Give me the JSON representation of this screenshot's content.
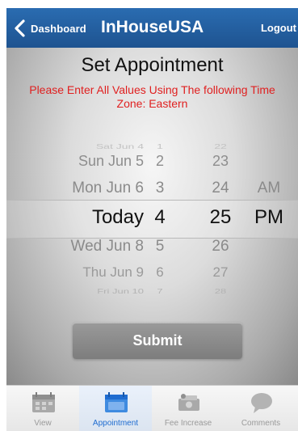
{
  "header": {
    "back_label": "Dashboard",
    "title": "InHouseUSA",
    "logout_label": "Logout"
  },
  "page": {
    "heading": "Set Appointment",
    "warning": "Please Enter All Values Using The following Time Zone: Eastern"
  },
  "picker": {
    "dates": [
      "Sat Jun 4",
      "Sun Jun 5",
      "Mon Jun 6",
      "Today",
      "Wed Jun 8",
      "Thu Jun 9",
      "Fri Jun 10"
    ],
    "hours": [
      "1",
      "2",
      "3",
      "4",
      "5",
      "6",
      "7"
    ],
    "minutes": [
      "22",
      "23",
      "24",
      "25",
      "26",
      "27",
      "28"
    ],
    "ampm": [
      "AM",
      "PM"
    ],
    "selected": {
      "date": "Today",
      "hour": "4",
      "minute": "25",
      "ampm": "PM"
    }
  },
  "submit_label": "Submit",
  "tabs": [
    {
      "label": "View",
      "icon": "calendar-icon"
    },
    {
      "label": "Appointment",
      "icon": "calendar-icon",
      "active": true
    },
    {
      "label": "Fee Increase",
      "icon": "money-icon"
    },
    {
      "label": "Comments",
      "icon": "speech-bubble-icon"
    }
  ],
  "colors": {
    "header_blue": "#1e5390",
    "warning_red": "#e02020",
    "active_tab": "#1f6cd0"
  }
}
